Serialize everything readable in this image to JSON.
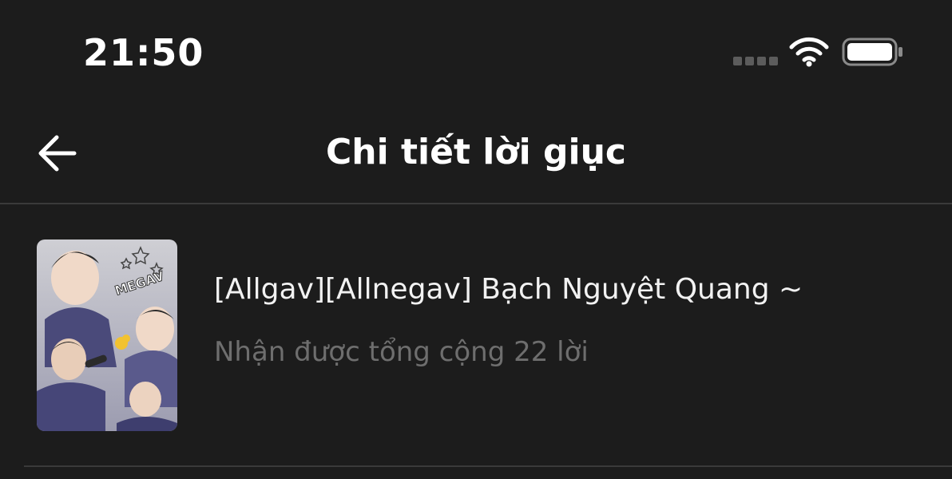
{
  "status_bar": {
    "time": "21:50",
    "icons": [
      "signal-icon",
      "wifi-icon",
      "battery-icon"
    ]
  },
  "nav": {
    "back_icon": "arrow-left-icon",
    "title": "Chi tiết lời giục"
  },
  "story": {
    "title": "[Allgav][Allnegav] Bạch Nguyệt Quang ~",
    "subtitle": "Nhận được tổng cộng 22 lời",
    "cover_text": "MEGAV"
  },
  "colors": {
    "background": "#1c1c1c",
    "divider": "#3a3a3a",
    "primary_text": "#ffffff",
    "secondary_text": "#6e6e6e",
    "cover_accent": "#4a4a7a"
  }
}
